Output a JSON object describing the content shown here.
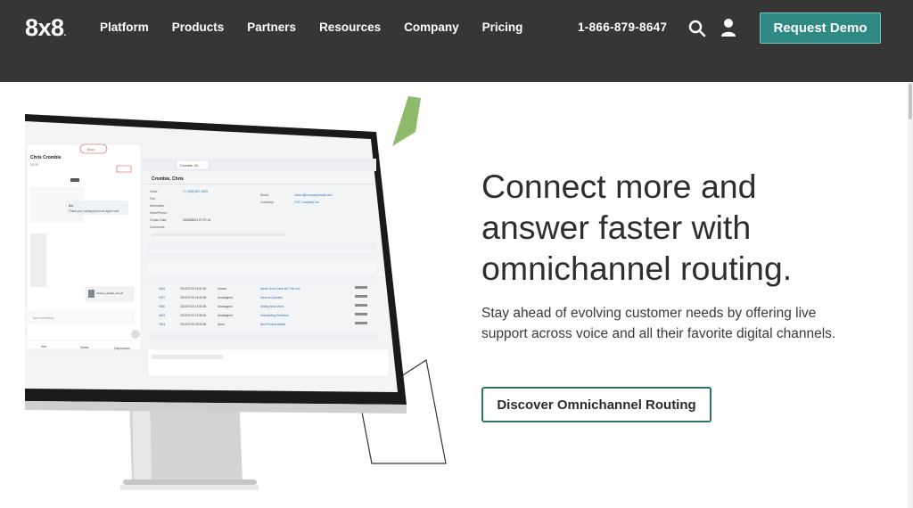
{
  "header": {
    "logo": "8x8",
    "nav": [
      "Platform",
      "Products",
      "Partners",
      "Resources",
      "Company",
      "Pricing"
    ],
    "phone": "1-866-879-8647",
    "search_icon": "search-icon",
    "user_icon": "user-icon",
    "demo_label": "Request Demo",
    "bg_color": "#363636",
    "accent_color": "#2f8a85"
  },
  "hero": {
    "title": "Connect more and answer faster with omnichannel routing.",
    "subtitle": "Stay ahead of evolving customer needs by offering live support across voice and all their favorite digital channels.",
    "cta_label": "Discover Omnichannel Routing"
  },
  "screen": {
    "contact_name": "Chris Crombie",
    "contact_time": "00:45",
    "status": "Busy",
    "tab_label": "Crombie, Ch...",
    "record_title": "Crombie, Chris",
    "phone_value": "+1 (555) 867-5309",
    "email_value": "chris.c@companyemail.com",
    "company_value": "XYZ Company Inc.",
    "created_date": "2023/08/24 07:27:14",
    "chat_message": "Thank you, routing you to an agent now.",
    "file_name": "Invoice_details_12.pdf",
    "input_placeholder": "Type something...",
    "case_rows": [
      {
        "id": "5456",
        "date": "2024/07/19 14:51:00",
        "status": "Closed",
        "subject": "Admin Does Gave Me This Link"
      },
      {
        "id": "1007",
        "date": "2024/07/19 16:45:55",
        "status": "Unassigned",
        "subject": "General Question"
      },
      {
        "id": "5456",
        "date": "2024/07/19 14:55:55",
        "status": "Unassigned",
        "subject": "Setting New Users"
      },
      {
        "id": "6453",
        "date": "2024/07/19 12:35:46",
        "status": "Unassigned",
        "subject": "Onboarding Feedback"
      },
      {
        "id": "7603",
        "date": "2024/07/19 09:26:56",
        "status": "Open",
        "subject": "New Product Added"
      }
    ],
    "bottom_tabs": [
      "Info",
      "Notes",
      "Disposition"
    ]
  }
}
